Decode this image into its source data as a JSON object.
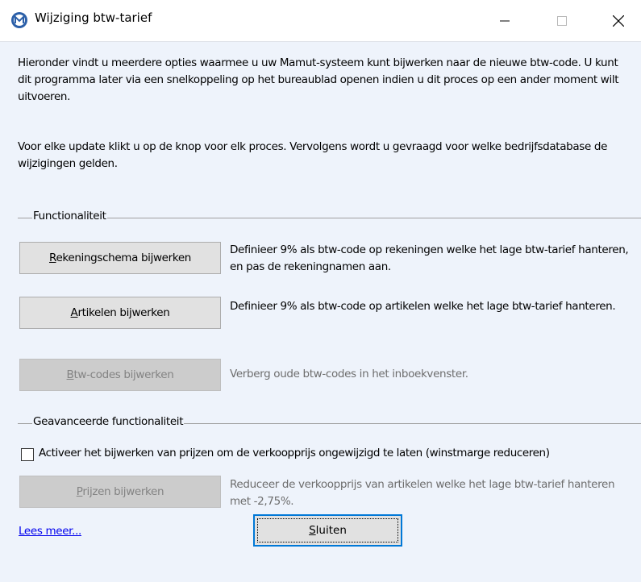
{
  "window": {
    "title": "Wijziging btw-tarief",
    "app_icon": "mamut-logo-icon",
    "controls": [
      "minimize-icon",
      "maximize-icon",
      "close-icon"
    ]
  },
  "intro": {
    "paragraph1": "Hieronder vindt u meerdere opties waarmee u uw Mamut-systeem kunt bijwerken naar de nieuwe btw-code. U kunt dit programma later via een snelkoppeling op het bureaublad openen indien u dit proces op een ander moment wilt uitvoeren.",
    "paragraph2": "Voor elke update klikt u op de knop voor elk proces. Vervolgens wordt u gevraagd voor welke bedrijfsdatabase de wijzigingen gelden."
  },
  "functionaliteit": {
    "group_label": "Functionaliteit",
    "rekeningschema": {
      "mnemonic": "R",
      "label_rest": "ekeningschema bijwerken",
      "description": "Definieer 9% als btw-code op rekeningen welke het lage btw-tarief hanteren, en pas de rekeningnamen aan.",
      "enabled": true
    },
    "artikelen": {
      "mnemonic": "A",
      "label_rest": "rtikelen bijwerken",
      "description": "Definieer 9% als btw-code op artikelen welke het lage btw-tarief hanteren.",
      "enabled": true
    },
    "btwcodes": {
      "mnemonic": "B",
      "label_rest": "tw-codes bijwerken",
      "description": "Verberg oude btw-codes in het inboekvenster.",
      "enabled": false
    }
  },
  "geavanceerd": {
    "group_label": "Geavanceerde functionaliteit",
    "checkbox_label": "Activeer het bijwerken van prijzen om de verkoopprijs ongewijzigd te laten (winstmarge reduceren)",
    "checkbox_checked": false,
    "prijzen": {
      "mnemonic": "P",
      "label_rest": "rijzen bijwerken",
      "description": "Reduceer de verkoopprijs van artikelen welke het lage btw-tarief hanteren met -2,75%.",
      "enabled": false
    }
  },
  "footer": {
    "link": "Lees meer...",
    "close_mnemonic": "S",
    "close_rest": "luiten"
  },
  "colors": {
    "background": "#eef3fb",
    "focus_border": "#0078d7",
    "link": "#0000ee"
  }
}
